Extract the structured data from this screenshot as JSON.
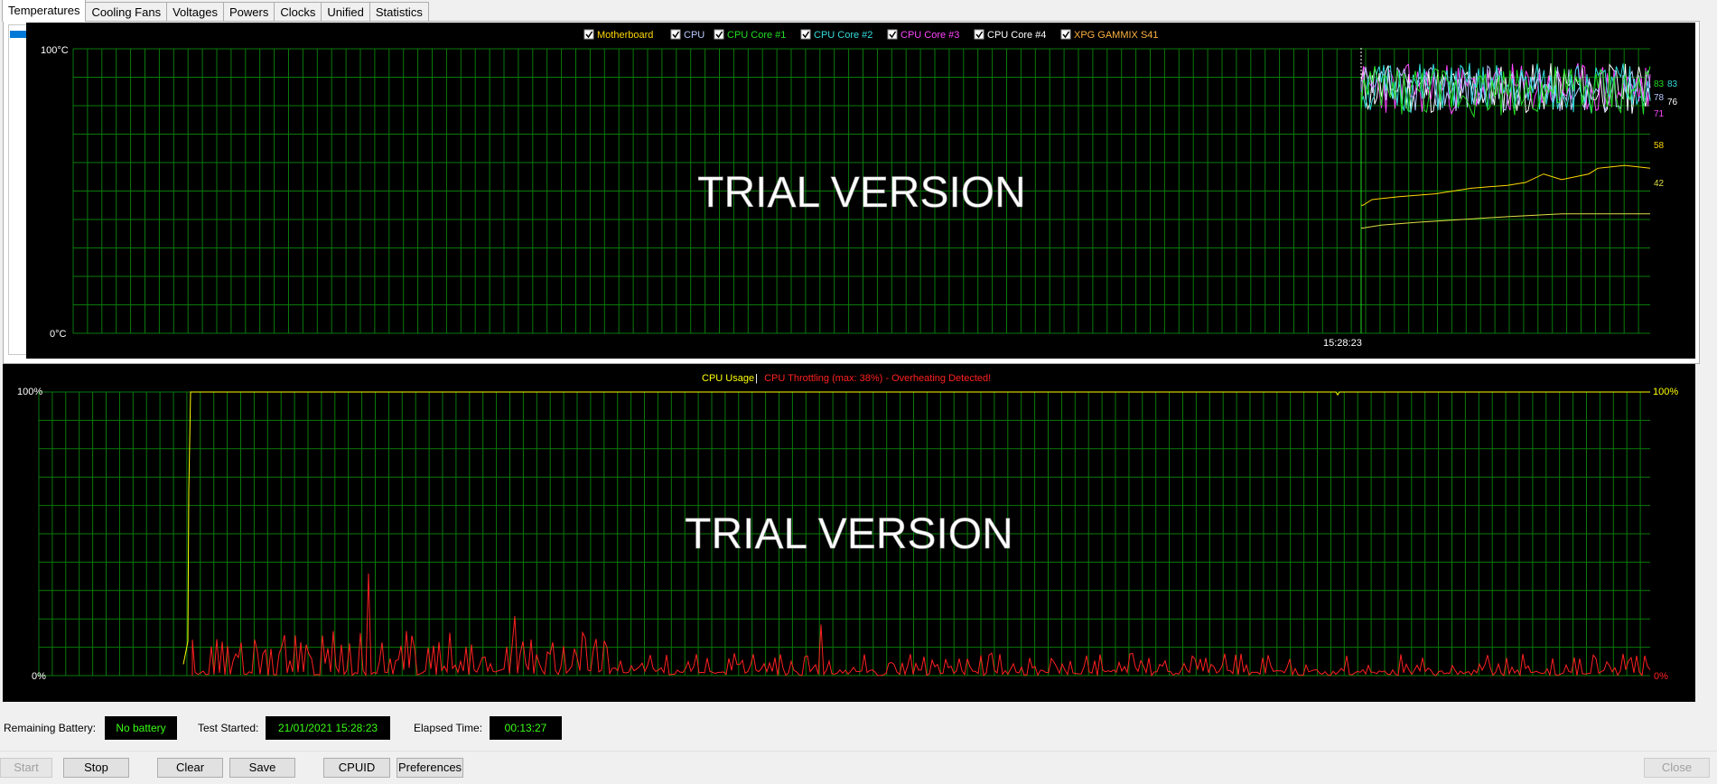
{
  "tabs": [
    {
      "label": "Temperatures",
      "active": true
    },
    {
      "label": "Cooling Fans",
      "active": false
    },
    {
      "label": "Voltages",
      "active": false
    },
    {
      "label": "Powers",
      "active": false
    },
    {
      "label": "Clocks",
      "active": false
    },
    {
      "label": "Unified",
      "active": false
    },
    {
      "label": "Statistics",
      "active": false
    }
  ],
  "temp_chart": {
    "legend": [
      {
        "label": "Motherboard",
        "color": "#ffd700",
        "checked": true
      },
      {
        "label": "CPU",
        "color": "#b8c8ff",
        "checked": true
      },
      {
        "label": "CPU Core #1",
        "color": "#22dd22",
        "checked": true
      },
      {
        "label": "CPU Core #2",
        "color": "#33dddd",
        "checked": true
      },
      {
        "label": "CPU Core #3",
        "color": "#ff44ff",
        "checked": true
      },
      {
        "label": "CPU Core #4",
        "color": "#ffffff",
        "checked": true
      },
      {
        "label": "XPG GAMMIX S41",
        "color": "#ffb040",
        "checked": true
      }
    ],
    "y_max_label": "100°C",
    "y_min_label": "0°C",
    "time_label": "15:28:23",
    "watermark": "TRIAL VERSION",
    "end_labels": [
      {
        "text": "83",
        "color": "#22dd22",
        "value": 83
      },
      {
        "text": "83",
        "color": "#33dddd",
        "value": 83
      },
      {
        "text": "78",
        "color": "#b8c8ff",
        "value": 78
      },
      {
        "text": "76",
        "color": "#ffffff",
        "value": 76
      },
      {
        "text": "71",
        "color": "#ff44ff",
        "value": 71
      },
      {
        "text": "58",
        "color": "#ffd700",
        "value": 58
      },
      {
        "text": "42",
        "color": "#dddd44",
        "value": 42
      }
    ]
  },
  "usage_chart": {
    "title_usage": "CPU Usage",
    "separator": "|",
    "title_throttle": "CPU Throttling (max: 38%) - Overheating Detected!",
    "usage_color": "#ffff00",
    "throttle_color": "#ff2020",
    "y_max_label": "100%",
    "y_min_label": "0%",
    "watermark": "TRIAL VERSION",
    "end_usage": "100%",
    "end_throttle": "0%"
  },
  "info": {
    "battery_label": "Remaining Battery:",
    "battery_value": "No battery",
    "started_label": "Test Started:",
    "started_value": "21/01/2021 15:28:23",
    "elapsed_label": "Elapsed Time:",
    "elapsed_value": "00:13:27"
  },
  "buttons": {
    "start": "Start",
    "stop": "Stop",
    "clear": "Clear",
    "save": "Save",
    "cpuid": "CPUID",
    "preferences": "Preferences",
    "close": "Close"
  }
}
